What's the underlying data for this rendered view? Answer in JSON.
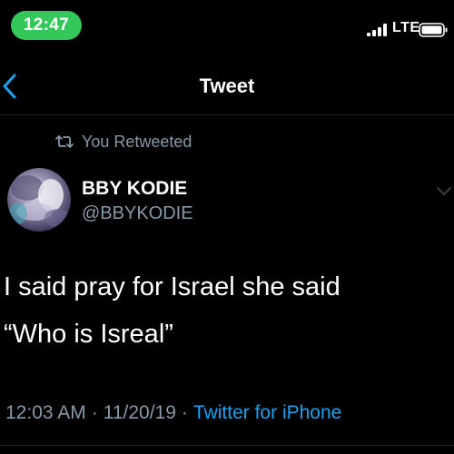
{
  "status_bar": {
    "time": "12:47",
    "network": "LTE",
    "colors": {
      "time_pill": "#34c759"
    }
  },
  "header": {
    "title": "Tweet",
    "back_icon": "chevron-left-icon",
    "accent": "#1da1f2"
  },
  "retweet": {
    "icon": "retweet-icon",
    "label": "You Retweeted"
  },
  "author": {
    "display_name": "BBY KODIE",
    "handle": "@BBYKODIE",
    "avatar": "profile-avatar"
  },
  "tweet": {
    "lines": [
      "I said pray for Israel she said",
      "“Who is Isreal”"
    ]
  },
  "meta": {
    "time": "12:03 AM",
    "separator": "·",
    "date": "11/20/19",
    "source": "Twitter for iPhone"
  },
  "colors": {
    "background": "#000000",
    "secondary_text": "#8899a6",
    "link": "#1da1f2",
    "divider": "#1f2326"
  }
}
